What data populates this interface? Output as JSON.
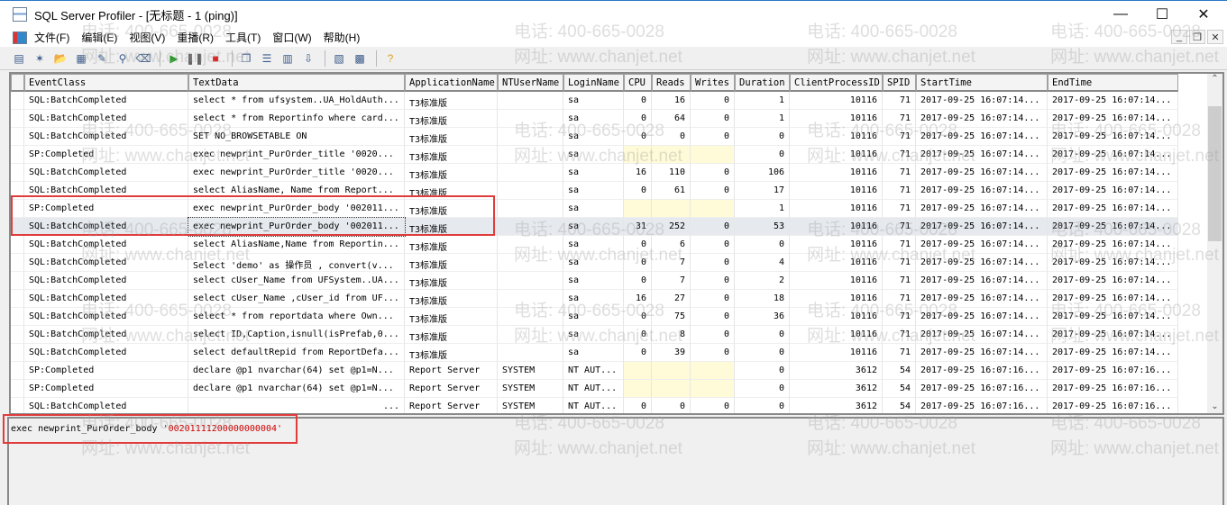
{
  "window": {
    "title": "SQL Server Profiler - [无标题 - 1 (ping)]",
    "minimize": "—",
    "maximize": "☐",
    "close": "✕"
  },
  "menu": [
    "文件(F)",
    "编辑(E)",
    "视图(V)",
    "重播(R)",
    "工具(T)",
    "窗口(W)",
    "帮助(H)"
  ],
  "mdi": {
    "minimize": "_",
    "restore": "❐",
    "close": "✕"
  },
  "toolbar": [
    "new-trace",
    "template",
    "open",
    "properties",
    "edit",
    "find",
    "clear",
    "|",
    "start",
    "pause",
    "stop",
    "|",
    "cascade",
    "tile-h",
    "tile-v",
    "autoscroll",
    "|",
    "perfmon",
    "chart",
    "|",
    "help"
  ],
  "columns": [
    "EventClass",
    "TextData",
    "ApplicationName",
    "NTUserName",
    "LoginName",
    "CPU",
    "Reads",
    "Writes",
    "Duration",
    "ClientProcessID",
    "SPID",
    "StartTime",
    "EndTime"
  ],
  "rows": [
    [
      "SQL:BatchCompleted",
      "select * from ufsystem..UA_HoldAuth...",
      "T3标准版",
      "",
      "sa",
      "0",
      "16",
      "0",
      "1",
      "10116",
      "71",
      "2017-09-25 16:07:14...",
      "2017-09-25 16:07:14..."
    ],
    [
      "SQL:BatchCompleted",
      "select * from Reportinfo where card...",
      "T3标准版",
      "",
      "sa",
      "0",
      "64",
      "0",
      "1",
      "10116",
      "71",
      "2017-09-25 16:07:14...",
      "2017-09-25 16:07:14..."
    ],
    [
      "SQL:BatchCompleted",
      "SET NO_BROWSETABLE ON",
      "T3标准版",
      "",
      "sa",
      "0",
      "0",
      "0",
      "0",
      "10116",
      "71",
      "2017-09-25 16:07:14...",
      "2017-09-25 16:07:14..."
    ],
    [
      "SP:Completed",
      "exec newprint_PurOrder_title '0020...",
      "T3标准版",
      "",
      "sa",
      "",
      "",
      "",
      "0",
      "10116",
      "71",
      "2017-09-25 16:07:14...",
      "2017-09-25 16:07:14..."
    ],
    [
      "SQL:BatchCompleted",
      "exec newprint_PurOrder_title  '0020...",
      "T3标准版",
      "",
      "sa",
      "16",
      "110",
      "0",
      "106",
      "10116",
      "71",
      "2017-09-25 16:07:14...",
      "2017-09-25 16:07:14..."
    ],
    [
      "SQL:BatchCompleted",
      "select  AliasName, Name from Report...",
      "T3标准版",
      "",
      "sa",
      "0",
      "61",
      "0",
      "17",
      "10116",
      "71",
      "2017-09-25 16:07:14...",
      "2017-09-25 16:07:14..."
    ],
    [
      "SP:Completed",
      "exec newprint_PurOrder_body '002011...",
      "T3标准版",
      "",
      "sa",
      "",
      "",
      "",
      "1",
      "10116",
      "71",
      "2017-09-25 16:07:14...",
      "2017-09-25 16:07:14..."
    ],
    [
      "SQL:BatchCompleted",
      "exec newprint_PurOrder_body '002011...",
      "T3标准版",
      "",
      "sa",
      "31",
      "252",
      "0",
      "53",
      "10116",
      "71",
      "2017-09-25 16:07:14...",
      "2017-09-25 16:07:14..."
    ],
    [
      "SQL:BatchCompleted",
      "select AliasName,Name from Reportin...",
      "T3标准版",
      "",
      "sa",
      "0",
      "6",
      "0",
      "0",
      "10116",
      "71",
      "2017-09-25 16:07:14...",
      "2017-09-25 16:07:14..."
    ],
    [
      "SQL:BatchCompleted",
      "Select 'demo' as 操作员 , convert(v...",
      "T3标准版",
      "",
      "sa",
      "0",
      "7",
      "0",
      "4",
      "10116",
      "71",
      "2017-09-25 16:07:14...",
      "2017-09-25 16:07:14..."
    ],
    [
      "SQL:BatchCompleted",
      "select cUser_Name from UFSystem..UA...",
      "T3标准版",
      "",
      "sa",
      "0",
      "7",
      "0",
      "2",
      "10116",
      "71",
      "2017-09-25 16:07:14...",
      "2017-09-25 16:07:14..."
    ],
    [
      "SQL:BatchCompleted",
      "select cUser_Name ,cUser_id from UF...",
      "T3标准版",
      "",
      "sa",
      "16",
      "27",
      "0",
      "18",
      "10116",
      "71",
      "2017-09-25 16:07:14...",
      "2017-09-25 16:07:14..."
    ],
    [
      "SQL:BatchCompleted",
      "select * from reportdata  where Own...",
      "T3标准版",
      "",
      "sa",
      "0",
      "75",
      "0",
      "36",
      "10116",
      "71",
      "2017-09-25 16:07:14...",
      "2017-09-25 16:07:14..."
    ],
    [
      "SQL:BatchCompleted",
      "select ID,Caption,isnull(isPrefab,0...",
      "T3标准版",
      "",
      "sa",
      "0",
      "8",
      "0",
      "0",
      "10116",
      "71",
      "2017-09-25 16:07:14...",
      "2017-09-25 16:07:14..."
    ],
    [
      "SQL:BatchCompleted",
      "select defaultRepid from ReportDefa...",
      "T3标准版",
      "",
      "sa",
      "0",
      "39",
      "0",
      "0",
      "10116",
      "71",
      "2017-09-25 16:07:14...",
      "2017-09-25 16:07:14..."
    ],
    [
      "SP:Completed",
      "declare @p1 nvarchar(64)  set @p1=N...",
      "Report Server",
      "SYSTEM",
      "NT AUT...",
      "",
      "",
      "",
      "0",
      "3612",
      "54",
      "2017-09-25 16:07:16...",
      "2017-09-25 16:07:16..."
    ],
    [
      "SP:Completed",
      "declare @p1 nvarchar(64)  set @p1=N...",
      "Report Server",
      "SYSTEM",
      "NT AUT...",
      "",
      "",
      "",
      "0",
      "3612",
      "54",
      "2017-09-25 16:07:16...",
      "2017-09-25 16:07:16..."
    ],
    [
      "SQL:BatchCompleted",
      "...",
      "Report Server",
      "SYSTEM",
      "NT AUT...",
      "0",
      "0",
      "0",
      "0",
      "3612",
      "54",
      "2017-09-25 16:07:16...",
      "2017-09-25 16:07:16..."
    ]
  ],
  "selected_row": 7,
  "detail": {
    "prefix": "exec newprint_PurOrder_body ",
    "string": "'00201111200000000004'"
  },
  "watermark": {
    "phone": "电话: 400-665-0028",
    "site": "网址: www.chanjet.net"
  },
  "colors": {
    "highlight": "#e03c3c",
    "string": "#cc0000",
    "empty_cell": "#fffbd8"
  }
}
